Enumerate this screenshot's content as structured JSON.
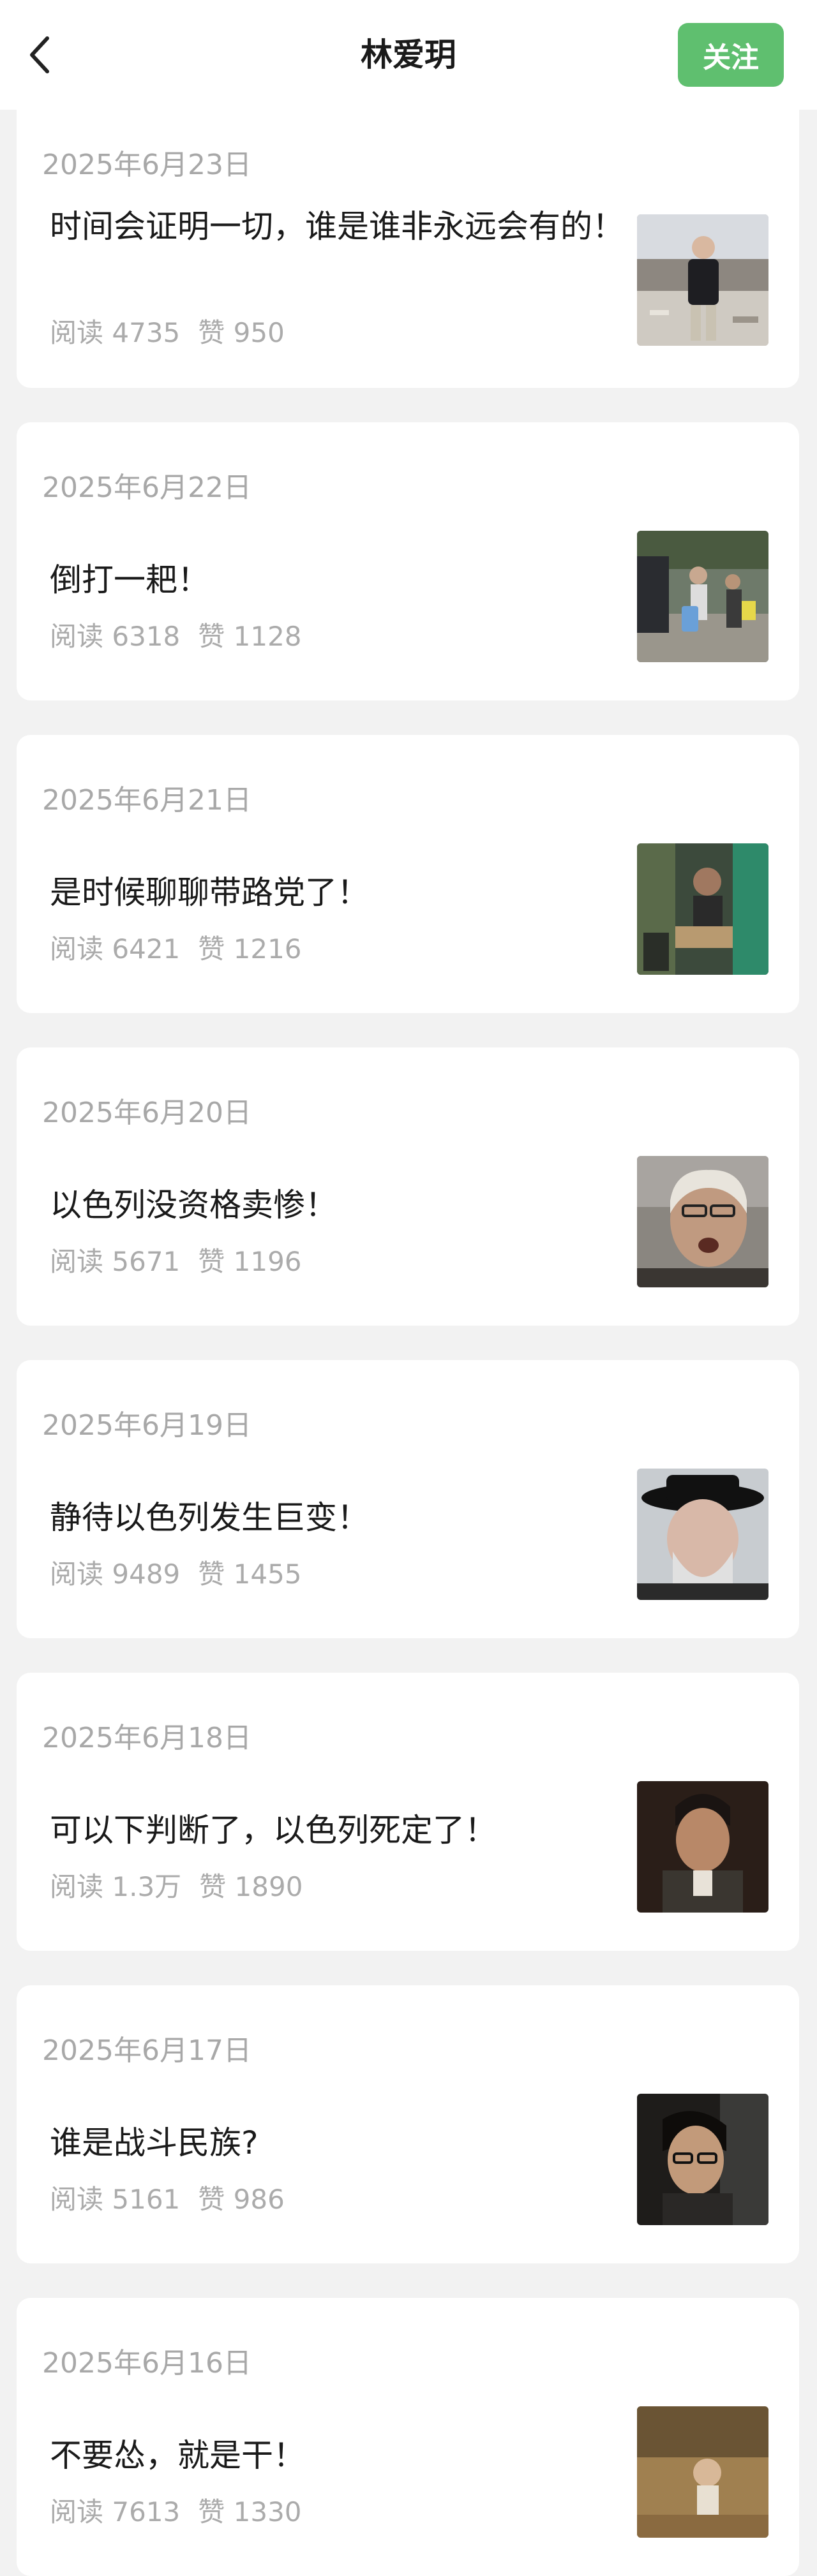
{
  "header": {
    "title": "林爱玥",
    "follow_label": "关注"
  },
  "posts": [
    {
      "date": "2025年6月23日",
      "title": "时间会证明一切，谁是谁非永远会有的！",
      "read_label": "阅读",
      "reads": "4735",
      "like_label": "赞",
      "likes": "950"
    },
    {
      "date": "2025年6月22日",
      "title": "倒打一耙！",
      "read_label": "阅读",
      "reads": "6318",
      "like_label": "赞",
      "likes": "1128"
    },
    {
      "date": "2025年6月21日",
      "title": "是时候聊聊带路党了！",
      "read_label": "阅读",
      "reads": "6421",
      "like_label": "赞",
      "likes": "1216"
    },
    {
      "date": "2025年6月20日",
      "title": "以色列没资格卖惨！",
      "read_label": "阅读",
      "reads": "5671",
      "like_label": "赞",
      "likes": "1196"
    },
    {
      "date": "2025年6月19日",
      "title": "静待以色列发生巨变！",
      "read_label": "阅读",
      "reads": "9489",
      "like_label": "赞",
      "likes": "1455"
    },
    {
      "date": "2025年6月18日",
      "title": "可以下判断了，以色列死定了！",
      "read_label": "阅读",
      "reads": "1.3万",
      "like_label": "赞",
      "likes": "1890"
    },
    {
      "date": "2025年6月17日",
      "title": "谁是战斗民族?",
      "read_label": "阅读",
      "reads": "5161",
      "like_label": "赞",
      "likes": "986"
    },
    {
      "date": "2025年6月16日",
      "title": "不要怂，就是干！",
      "read_label": "阅读",
      "reads": "7613",
      "like_label": "赞",
      "likes": "1330"
    }
  ],
  "colors": {
    "accent": "#5fbf6f",
    "background": "#f2f2f2",
    "muted_text": "#a8a8a8"
  },
  "icons": {
    "back": "chevron-left-icon"
  }
}
